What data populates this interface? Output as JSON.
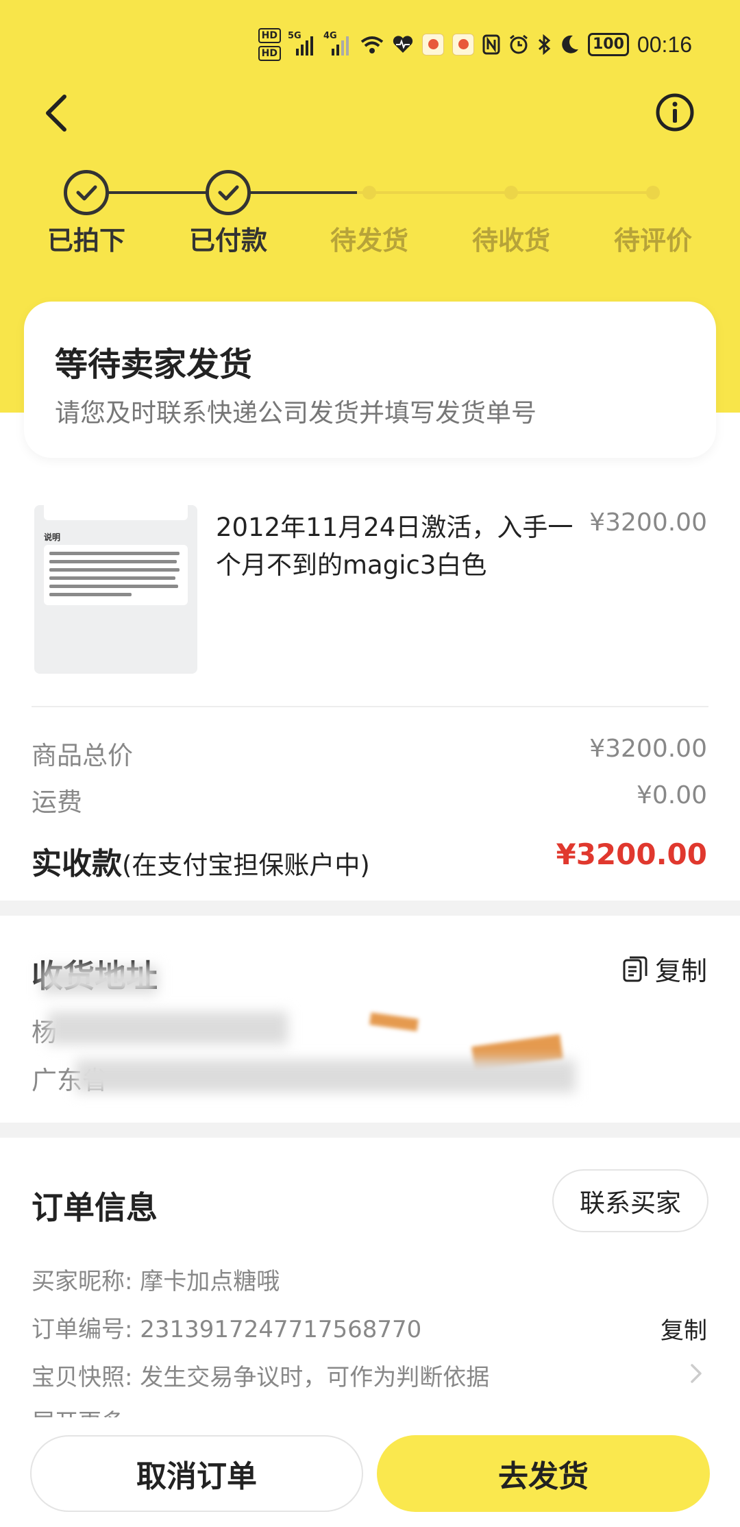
{
  "status_bar": {
    "time": "00:16",
    "battery": "100",
    "hd1": "HD",
    "hd2": "HD",
    "net1": "5G",
    "net2": "4G"
  },
  "steps": [
    {
      "label": "已拍下",
      "state": "done"
    },
    {
      "label": "已付款",
      "state": "done"
    },
    {
      "label": "待发货",
      "state": "pending"
    },
    {
      "label": "待收货",
      "state": "pending"
    },
    {
      "label": "待评价",
      "state": "pending"
    }
  ],
  "status": {
    "title": "等待卖家发货",
    "desc": "请您及时联系快递公司发货并填写发货单号"
  },
  "product": {
    "thumb_title": "说明",
    "title": "2012年11月24日激活，入手一个月不到的magic3白色",
    "price": "¥3200.00"
  },
  "fees": {
    "goods_total_label": "商品总价",
    "goods_total_value": "¥3200.00",
    "shipping_label": "运费",
    "shipping_value": "¥0.00",
    "received_label": "实收款",
    "received_note": "(在支付宝担保账户中)",
    "received_value": "¥3200.00"
  },
  "address": {
    "title": "收货地址",
    "copy_label": "复制",
    "name_visible": "杨",
    "region_visible": "广东省"
  },
  "order": {
    "title": "订单信息",
    "contact_label": "联系买家",
    "buyer_label": "买家昵称: ",
    "buyer_value": "摩卡加点糖哦",
    "number_label": "订单编号: ",
    "number_value": "2313917247717568770",
    "copy_label": "复制",
    "snapshot_label": "宝贝快照: ",
    "snapshot_value": "发生交易争议时，可作为判断依据",
    "more_label": "展开更多"
  },
  "actions": {
    "cancel_label": "取消订单",
    "ship_label": "去发货"
  },
  "colors": {
    "brand_yellow": "#f8e54a",
    "price_red": "#e0382e"
  }
}
